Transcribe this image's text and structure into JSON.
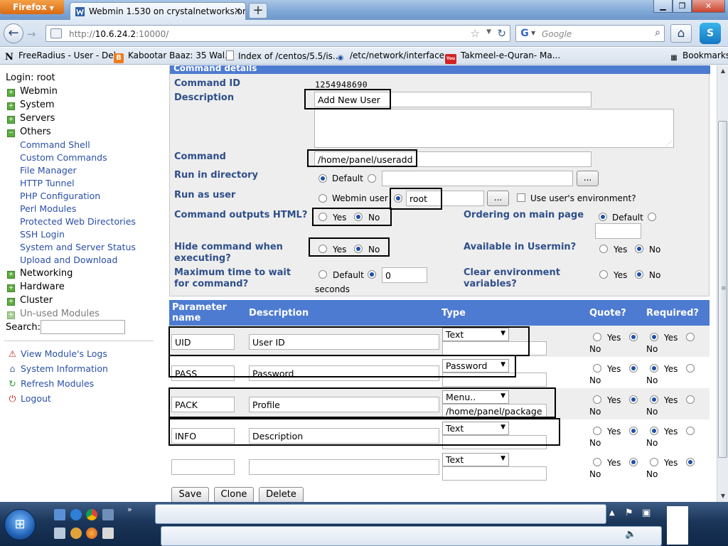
{
  "browser": {
    "app_button": "Firefox",
    "tab_title": "Webmin 1.530 on crystalnetworks.org (U...",
    "url_prefix": "http://",
    "url_host": "10.6.24.2",
    "url_suffix": ":10000/",
    "search_placeholder": "Google",
    "bookmarks": [
      {
        "label": "FreeRadius - User - Del...",
        "icon": "N"
      },
      {
        "label": "Kabootar Baaz: 35 Wal...",
        "icon": "B"
      },
      {
        "label": "Index of /centos/5.5/is...",
        "icon": ""
      },
      {
        "label": "/etc/network/interface...",
        "icon": ""
      },
      {
        "label": "Takmeel-e-Quran- Ma...",
        "icon": "You"
      }
    ],
    "bookmarks_menu": "Bookmarks"
  },
  "sidebar": {
    "login": "Login: root",
    "categories": [
      "Webmin",
      "System",
      "Servers",
      "Others"
    ],
    "others_items": [
      "Command Shell",
      "Custom Commands",
      "File Manager",
      "HTTP Tunnel",
      "PHP Configuration",
      "Perl Modules",
      "Protected Web Directories",
      "SSH Login",
      "System and Server Status",
      "Upload and Download"
    ],
    "more_categories": [
      "Networking",
      "Hardware",
      "Cluster"
    ],
    "unused": "Un-used Modules",
    "search_label": "Search:",
    "actions": [
      "View Module's Logs",
      "System Information",
      "Refresh Modules",
      "Logout"
    ]
  },
  "form": {
    "section_title": "Command details",
    "command_id_label": "Command ID",
    "command_id_value": "1254948690",
    "description_label": "Description",
    "description_value": "Add New User",
    "command_label": "Command",
    "command_value": "/home/panel/useradd",
    "run_dir_label": "Run in directory",
    "run_dir_default": "Default",
    "browse_label": "...",
    "run_as_label": "Run as user",
    "run_as_webmin": "Webmin user",
    "run_as_value": "root",
    "use_env": "Use user's environment?",
    "outputs_html_label": "Command outputs HTML?",
    "yes": "Yes",
    "no": "No",
    "ordering_label": "Ordering on main page",
    "ordering_default": "Default",
    "hide_label": "Hide command when executing?",
    "usermin_label": "Available in Usermin?",
    "maxtime_label": "Maximum time to wait for command?",
    "maxtime_default": "Default",
    "maxtime_value": "0",
    "maxtime_unit": "seconds",
    "clear_env_label": "Clear environment variables?"
  },
  "params": {
    "headers": [
      "Parameter name",
      "Description",
      "Type",
      "Quote?",
      "Required?"
    ],
    "rows": [
      {
        "name": "UID",
        "desc": "User ID",
        "type": "Text",
        "extra": ""
      },
      {
        "name": "PASS",
        "desc": "Password",
        "type": "Password",
        "extra": ""
      },
      {
        "name": "PACK",
        "desc": "Profile",
        "type": "Menu..",
        "extra": "/home/panel/package"
      },
      {
        "name": "INFO",
        "desc": "Description",
        "type": "Text",
        "extra": ""
      },
      {
        "name": "",
        "desc": "",
        "type": "Text",
        "extra": ""
      }
    ]
  },
  "buttons": {
    "save": "Save",
    "clone": "Clone",
    "delete": "Delete"
  }
}
